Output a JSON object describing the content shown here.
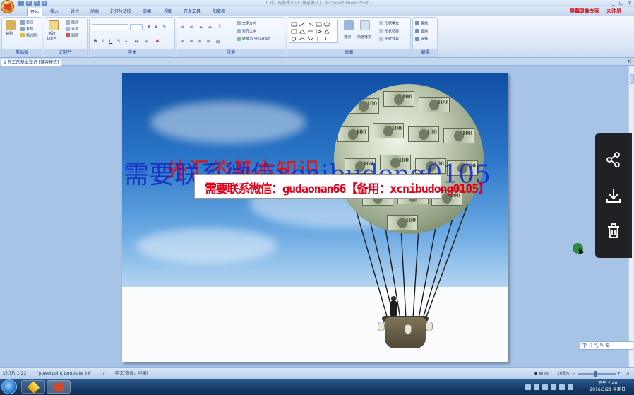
{
  "window": {
    "title": "1 外汇的基本知识 [兼容模式] - Microsoft PowerPoint",
    "controls": [
      "_",
      "□",
      "×"
    ]
  },
  "ribbon_tabs": [
    "开始",
    "插入",
    "设计",
    "动画",
    "幻灯片放映",
    "审阅",
    "视图",
    "开发工具",
    "加载项"
  ],
  "ribbon_right": [
    "屏幕录像专家",
    "未注册"
  ],
  "ribbon": {
    "clipboard": {
      "label": "剪贴板",
      "paste": "粘贴",
      "cut": "剪切",
      "copy": "复制",
      "format_painter": "格式刷"
    },
    "slides": {
      "label": "幻灯片",
      "new_slide": "新建\n幻灯片",
      "layout": "版式",
      "reset": "重设",
      "delete": "删除"
    },
    "font": {
      "label": "字体"
    },
    "paragraph": {
      "label": "段落",
      "text_direction": "文字方向",
      "align_text": "对齐文本",
      "smartart": "转换为 SmartArt"
    },
    "drawing": {
      "label": "绘图",
      "arrange": "排列",
      "quick_styles": "快速样式",
      "shape_fill": "形状填充",
      "shape_outline": "形状轮廓",
      "shape_effects": "形状效果"
    },
    "editing": {
      "label": "编辑",
      "find": "查找",
      "replace": "替换",
      "select": "选择"
    }
  },
  "document_tab": "1 外汇的基本知识 [兼容模式]",
  "slide": {
    "title": "外汇的基本知识",
    "overlay_text": "需要联系微信xcnibudong0105",
    "banner": "需要联系微信：gudaonan66【备用：xcnibudong0105】",
    "bill_value": "100"
  },
  "statusbar": {
    "slide_info": "幻灯片 1/22",
    "theme": "\"powerpoint template 24\"",
    "language": "中文(简体，中国)",
    "zoom": "106%"
  },
  "ime": "中",
  "taskbar": {
    "time": "下午 2:40",
    "date": "2016/3/21 星期日"
  },
  "colors": {
    "title_red": "#e0141b",
    "overlay_blue": "#1427c9",
    "banner_red": "#e0001a"
  }
}
